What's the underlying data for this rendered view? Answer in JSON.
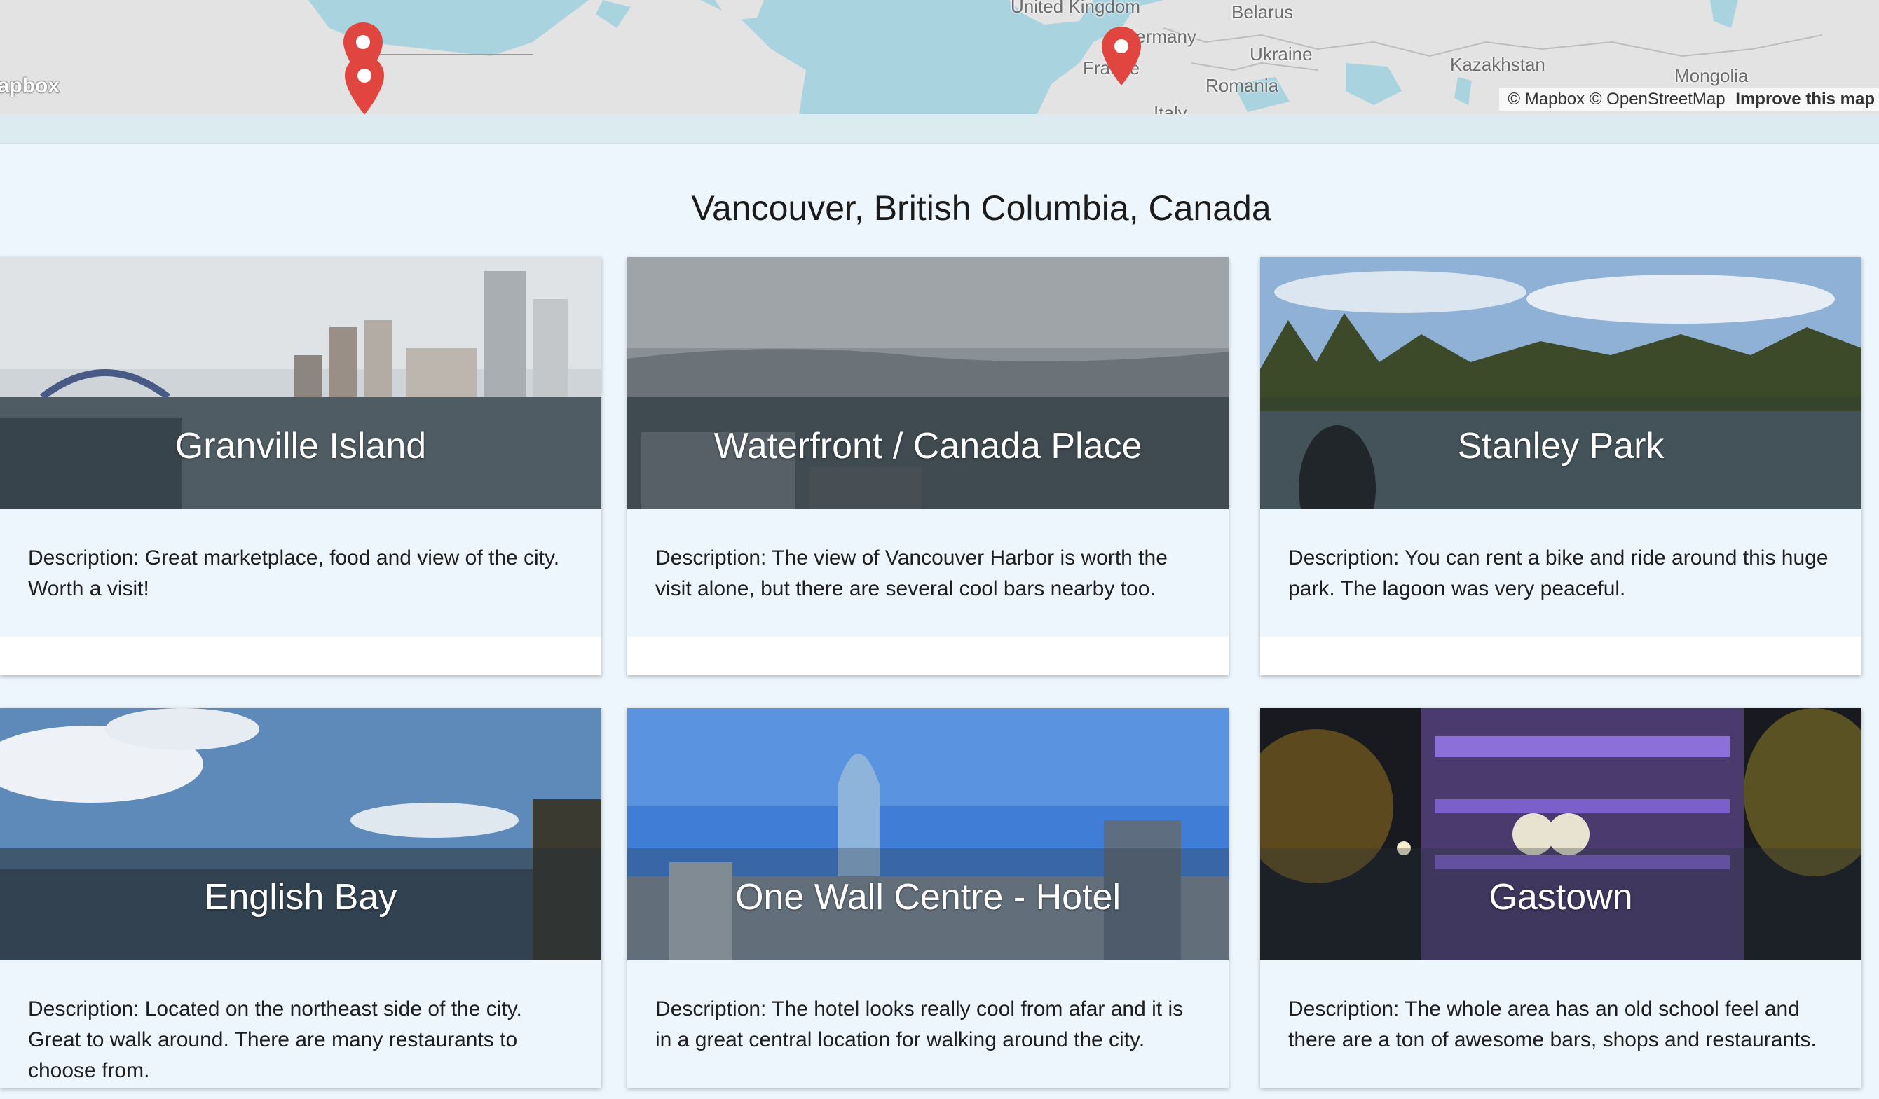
{
  "map": {
    "logo_text": "mapbox",
    "labels": [
      "United Kingdom",
      "Belarus",
      "Germany",
      "Ukraine",
      "France",
      "Romania",
      "Kazakhstan",
      "Mongolia",
      "Italy"
    ],
    "attribution": {
      "mapbox": "© Mapbox",
      "osm": "© OpenStreetMap",
      "improve": "Improve this map"
    },
    "marker_color": "#e0463f",
    "water_color": "#a9d3df",
    "land_color": "#e3e3e3"
  },
  "city": {
    "title": "Vancouver, British Columbia, Canada"
  },
  "places": [
    {
      "name": "Granville Island",
      "description": "Description: Great marketplace, food and view of the city. Worth a visit!"
    },
    {
      "name": "Waterfront / Canada Place",
      "description": "Description: The view of Vancouver Harbor is worth the visit alone, but there are several cool bars nearby too."
    },
    {
      "name": "Stanley Park",
      "description": "Description: You can rent a bike and ride around this huge park. The lagoon was very peaceful."
    },
    {
      "name": "English Bay",
      "description": "Description: Located on the northeast side of the city. Great to walk around. There are many restaurants to choose from."
    },
    {
      "name": "One Wall Centre - Hotel",
      "description": "Description: The hotel looks really cool from afar and it is in a great central location for walking around the city."
    },
    {
      "name": "Gastown",
      "description": "Description: The whole area has an old school feel and there are a ton of awesome bars, shops and restaurants."
    }
  ]
}
